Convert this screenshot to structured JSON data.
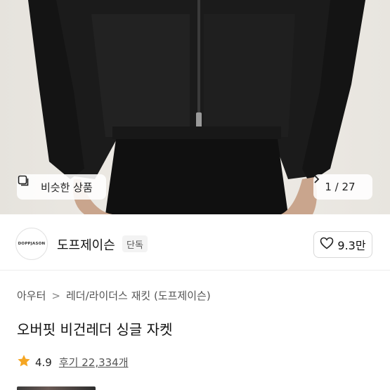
{
  "hero": {
    "similar_label": "비슷한 상품",
    "counter": "1 / 27",
    "similar_icon": "similar-items-icon",
    "next_icon": "chevron-right-icon"
  },
  "brand": {
    "logo_text": "DOPPJASON",
    "name": "도프제이슨",
    "badge": "단독",
    "likes": "9.3만",
    "like_icon": "heart-icon"
  },
  "breadcrumb": {
    "items": [
      "아우터",
      "레더/라이더스 재킷 (도프제이슨)"
    ],
    "separator": ">"
  },
  "product": {
    "title": "오버핏 비건레더 싱글 자켓",
    "rating": "4.9",
    "reviews": "후기 22,334개",
    "star_color": "#f5a623"
  }
}
